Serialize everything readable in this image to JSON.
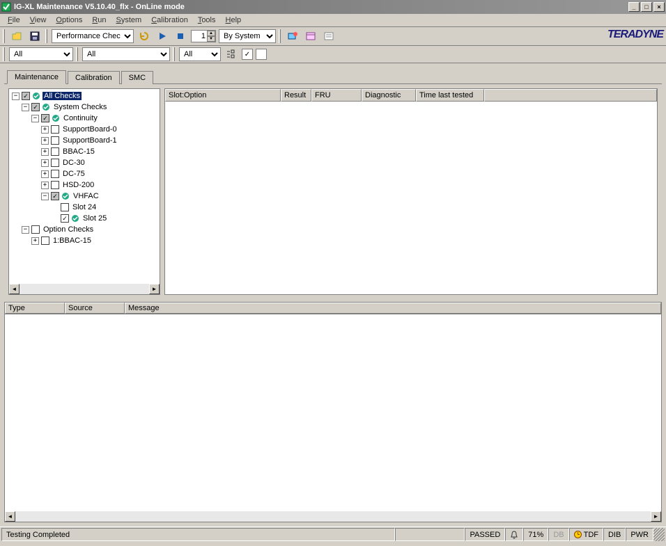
{
  "window": {
    "title": "IG-XL Maintenance V5.10.40_flx - OnLine mode"
  },
  "menu": {
    "file": "File",
    "view": "View",
    "options": "Options",
    "run": "Run",
    "system": "System",
    "calibration": "Calibration",
    "tools": "Tools",
    "help": "Help"
  },
  "toolbar1": {
    "mode": "Performance Check",
    "loopCount": "1",
    "groupBy": "By System"
  },
  "toolbar2": {
    "f1": "All",
    "f2": "All",
    "f3": "All"
  },
  "brand": "TERADYNE",
  "tabs": {
    "t1": "Maintenance",
    "t2": "Calibration",
    "t3": "SMC"
  },
  "tree": {
    "root": "All Checks",
    "system": "System Checks",
    "continuity": "Continuity",
    "sb0": "SupportBoard-0",
    "sb1": "SupportBoard-1",
    "bbac15": "BBAC-15",
    "dc30": "DC-30",
    "dc75": "DC-75",
    "hsd200": "HSD-200",
    "vhfac": "VHFAC",
    "slot24": "Slot 24",
    "slot25": "Slot 25",
    "option": "Option Checks",
    "opt1": "1:BBAC-15"
  },
  "grid": {
    "cols": {
      "c1": "Slot:Option",
      "c2": "Result",
      "c3": "FRU",
      "c4": "Diagnostic",
      "c5": "Time last tested"
    }
  },
  "messages": {
    "cols": {
      "c1": "Type",
      "c2": "Source",
      "c3": "Message"
    }
  },
  "status": {
    "text": "Testing Completed",
    "result": "PASSED",
    "percent": "71%",
    "db": "DB",
    "tdf": "TDF",
    "dib": "DIB",
    "pwr": "PWR"
  }
}
